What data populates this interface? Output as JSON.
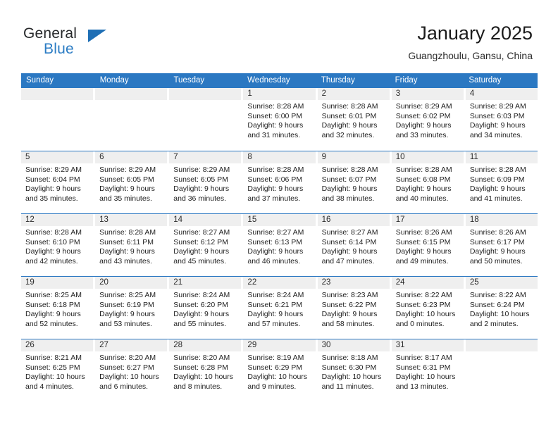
{
  "brand": {
    "line1": "General",
    "line2": "Blue",
    "triangle_color": "#1f6fb5",
    "blue_color": "#2b7cc4"
  },
  "header": {
    "title": "January 2025",
    "subtitle": "Guangzhoulu, Gansu, China"
  },
  "colors": {
    "header_bar": "#2b78c2",
    "cell_head": "#efefef",
    "text": "#1e1e1e"
  },
  "day_headers": [
    "Sunday",
    "Monday",
    "Tuesday",
    "Wednesday",
    "Thursday",
    "Friday",
    "Saturday"
  ],
  "weeks": [
    [
      {
        "day": "",
        "sunrise": "",
        "sunset": "",
        "daylight1": "",
        "daylight2": ""
      },
      {
        "day": "",
        "sunrise": "",
        "sunset": "",
        "daylight1": "",
        "daylight2": ""
      },
      {
        "day": "",
        "sunrise": "",
        "sunset": "",
        "daylight1": "",
        "daylight2": ""
      },
      {
        "day": "1",
        "sunrise": "Sunrise: 8:28 AM",
        "sunset": "Sunset: 6:00 PM",
        "daylight1": "Daylight: 9 hours",
        "daylight2": "and 31 minutes."
      },
      {
        "day": "2",
        "sunrise": "Sunrise: 8:28 AM",
        "sunset": "Sunset: 6:01 PM",
        "daylight1": "Daylight: 9 hours",
        "daylight2": "and 32 minutes."
      },
      {
        "day": "3",
        "sunrise": "Sunrise: 8:29 AM",
        "sunset": "Sunset: 6:02 PM",
        "daylight1": "Daylight: 9 hours",
        "daylight2": "and 33 minutes."
      },
      {
        "day": "4",
        "sunrise": "Sunrise: 8:29 AM",
        "sunset": "Sunset: 6:03 PM",
        "daylight1": "Daylight: 9 hours",
        "daylight2": "and 34 minutes."
      }
    ],
    [
      {
        "day": "5",
        "sunrise": "Sunrise: 8:29 AM",
        "sunset": "Sunset: 6:04 PM",
        "daylight1": "Daylight: 9 hours",
        "daylight2": "and 35 minutes."
      },
      {
        "day": "6",
        "sunrise": "Sunrise: 8:29 AM",
        "sunset": "Sunset: 6:05 PM",
        "daylight1": "Daylight: 9 hours",
        "daylight2": "and 35 minutes."
      },
      {
        "day": "7",
        "sunrise": "Sunrise: 8:29 AM",
        "sunset": "Sunset: 6:05 PM",
        "daylight1": "Daylight: 9 hours",
        "daylight2": "and 36 minutes."
      },
      {
        "day": "8",
        "sunrise": "Sunrise: 8:28 AM",
        "sunset": "Sunset: 6:06 PM",
        "daylight1": "Daylight: 9 hours",
        "daylight2": "and 37 minutes."
      },
      {
        "day": "9",
        "sunrise": "Sunrise: 8:28 AM",
        "sunset": "Sunset: 6:07 PM",
        "daylight1": "Daylight: 9 hours",
        "daylight2": "and 38 minutes."
      },
      {
        "day": "10",
        "sunrise": "Sunrise: 8:28 AM",
        "sunset": "Sunset: 6:08 PM",
        "daylight1": "Daylight: 9 hours",
        "daylight2": "and 40 minutes."
      },
      {
        "day": "11",
        "sunrise": "Sunrise: 8:28 AM",
        "sunset": "Sunset: 6:09 PM",
        "daylight1": "Daylight: 9 hours",
        "daylight2": "and 41 minutes."
      }
    ],
    [
      {
        "day": "12",
        "sunrise": "Sunrise: 8:28 AM",
        "sunset": "Sunset: 6:10 PM",
        "daylight1": "Daylight: 9 hours",
        "daylight2": "and 42 minutes."
      },
      {
        "day": "13",
        "sunrise": "Sunrise: 8:28 AM",
        "sunset": "Sunset: 6:11 PM",
        "daylight1": "Daylight: 9 hours",
        "daylight2": "and 43 minutes."
      },
      {
        "day": "14",
        "sunrise": "Sunrise: 8:27 AM",
        "sunset": "Sunset: 6:12 PM",
        "daylight1": "Daylight: 9 hours",
        "daylight2": "and 45 minutes."
      },
      {
        "day": "15",
        "sunrise": "Sunrise: 8:27 AM",
        "sunset": "Sunset: 6:13 PM",
        "daylight1": "Daylight: 9 hours",
        "daylight2": "and 46 minutes."
      },
      {
        "day": "16",
        "sunrise": "Sunrise: 8:27 AM",
        "sunset": "Sunset: 6:14 PM",
        "daylight1": "Daylight: 9 hours",
        "daylight2": "and 47 minutes."
      },
      {
        "day": "17",
        "sunrise": "Sunrise: 8:26 AM",
        "sunset": "Sunset: 6:15 PM",
        "daylight1": "Daylight: 9 hours",
        "daylight2": "and 49 minutes."
      },
      {
        "day": "18",
        "sunrise": "Sunrise: 8:26 AM",
        "sunset": "Sunset: 6:17 PM",
        "daylight1": "Daylight: 9 hours",
        "daylight2": "and 50 minutes."
      }
    ],
    [
      {
        "day": "19",
        "sunrise": "Sunrise: 8:25 AM",
        "sunset": "Sunset: 6:18 PM",
        "daylight1": "Daylight: 9 hours",
        "daylight2": "and 52 minutes."
      },
      {
        "day": "20",
        "sunrise": "Sunrise: 8:25 AM",
        "sunset": "Sunset: 6:19 PM",
        "daylight1": "Daylight: 9 hours",
        "daylight2": "and 53 minutes."
      },
      {
        "day": "21",
        "sunrise": "Sunrise: 8:24 AM",
        "sunset": "Sunset: 6:20 PM",
        "daylight1": "Daylight: 9 hours",
        "daylight2": "and 55 minutes."
      },
      {
        "day": "22",
        "sunrise": "Sunrise: 8:24 AM",
        "sunset": "Sunset: 6:21 PM",
        "daylight1": "Daylight: 9 hours",
        "daylight2": "and 57 minutes."
      },
      {
        "day": "23",
        "sunrise": "Sunrise: 8:23 AM",
        "sunset": "Sunset: 6:22 PM",
        "daylight1": "Daylight: 9 hours",
        "daylight2": "and 58 minutes."
      },
      {
        "day": "24",
        "sunrise": "Sunrise: 8:22 AM",
        "sunset": "Sunset: 6:23 PM",
        "daylight1": "Daylight: 10 hours",
        "daylight2": "and 0 minutes."
      },
      {
        "day": "25",
        "sunrise": "Sunrise: 8:22 AM",
        "sunset": "Sunset: 6:24 PM",
        "daylight1": "Daylight: 10 hours",
        "daylight2": "and 2 minutes."
      }
    ],
    [
      {
        "day": "26",
        "sunrise": "Sunrise: 8:21 AM",
        "sunset": "Sunset: 6:25 PM",
        "daylight1": "Daylight: 10 hours",
        "daylight2": "and 4 minutes."
      },
      {
        "day": "27",
        "sunrise": "Sunrise: 8:20 AM",
        "sunset": "Sunset: 6:27 PM",
        "daylight1": "Daylight: 10 hours",
        "daylight2": "and 6 minutes."
      },
      {
        "day": "28",
        "sunrise": "Sunrise: 8:20 AM",
        "sunset": "Sunset: 6:28 PM",
        "daylight1": "Daylight: 10 hours",
        "daylight2": "and 8 minutes."
      },
      {
        "day": "29",
        "sunrise": "Sunrise: 8:19 AM",
        "sunset": "Sunset: 6:29 PM",
        "daylight1": "Daylight: 10 hours",
        "daylight2": "and 9 minutes."
      },
      {
        "day": "30",
        "sunrise": "Sunrise: 8:18 AM",
        "sunset": "Sunset: 6:30 PM",
        "daylight1": "Daylight: 10 hours",
        "daylight2": "and 11 minutes."
      },
      {
        "day": "31",
        "sunrise": "Sunrise: 8:17 AM",
        "sunset": "Sunset: 6:31 PM",
        "daylight1": "Daylight: 10 hours",
        "daylight2": "and 13 minutes."
      },
      {
        "day": "",
        "sunrise": "",
        "sunset": "",
        "daylight1": "",
        "daylight2": ""
      }
    ]
  ]
}
